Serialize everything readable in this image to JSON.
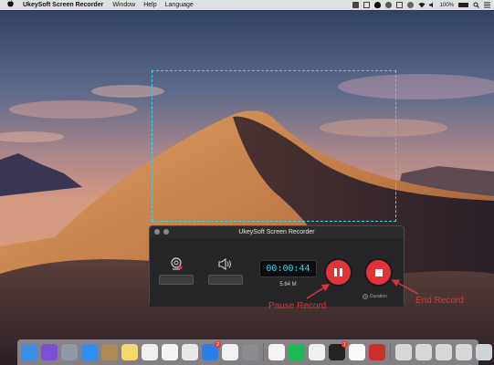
{
  "menubar": {
    "apple_icon": "apple-logo-icon",
    "app_name": "UkeySoft Screen Recorder",
    "menus": [
      "Window",
      "Help",
      "Language"
    ],
    "status": {
      "battery_text": "100%"
    }
  },
  "recorder": {
    "title": "UkeySoft Screen Recorder",
    "timer": "00:00:44",
    "file_size": "5.64 M",
    "duration_label": "Duration",
    "accent": "#e03438",
    "timer_color": "#3fd0e6"
  },
  "annotations": {
    "pause": "Pause Record",
    "end": "End Record"
  },
  "dock": {
    "icons": [
      {
        "name": "finder-icon",
        "color": "#3a8ee6"
      },
      {
        "name": "siri-icon",
        "color": "#7b4fd6"
      },
      {
        "name": "launchpad-icon",
        "color": "#8f9aa8"
      },
      {
        "name": "safari-icon",
        "color": "#2f8ef0"
      },
      {
        "name": "notes-book-icon",
        "color": "#b08a55"
      },
      {
        "name": "stickies-icon",
        "color": "#f3d86b"
      },
      {
        "name": "photos-icon",
        "color": "#f0f0f0"
      },
      {
        "name": "reminders-icon",
        "color": "#f5f5f5"
      },
      {
        "name": "textedit-icon",
        "color": "#e8e8e8"
      },
      {
        "name": "app-store-icon",
        "color": "#2a7fe8",
        "badge": "2"
      },
      {
        "name": "chrome-icon",
        "color": "#f2f2f2"
      },
      {
        "name": "system-preferences-icon",
        "color": "#8b8b8f"
      },
      {
        "name": "itunes-icon",
        "color": "#f4f4f4"
      },
      {
        "name": "spotify-icon",
        "color": "#1db954"
      },
      {
        "name": "blocked-app-icon",
        "color": "#f0f0f0"
      },
      {
        "name": "qq-icon",
        "color": "#222222",
        "badge": "1"
      },
      {
        "name": "document-icon",
        "color": "#fafafa"
      },
      {
        "name": "recorder-dock-icon",
        "color": "#c9302c"
      },
      {
        "name": "window-thumb-icon",
        "color": "#d8d8d8"
      },
      {
        "name": "window-thumb-icon",
        "color": "#d8d8d8"
      },
      {
        "name": "window-thumb-icon",
        "color": "#d8d8d8"
      },
      {
        "name": "window-thumb-icon",
        "color": "#d8d8d8"
      },
      {
        "name": "trash-icon",
        "color": "#cfd4da"
      }
    ]
  }
}
